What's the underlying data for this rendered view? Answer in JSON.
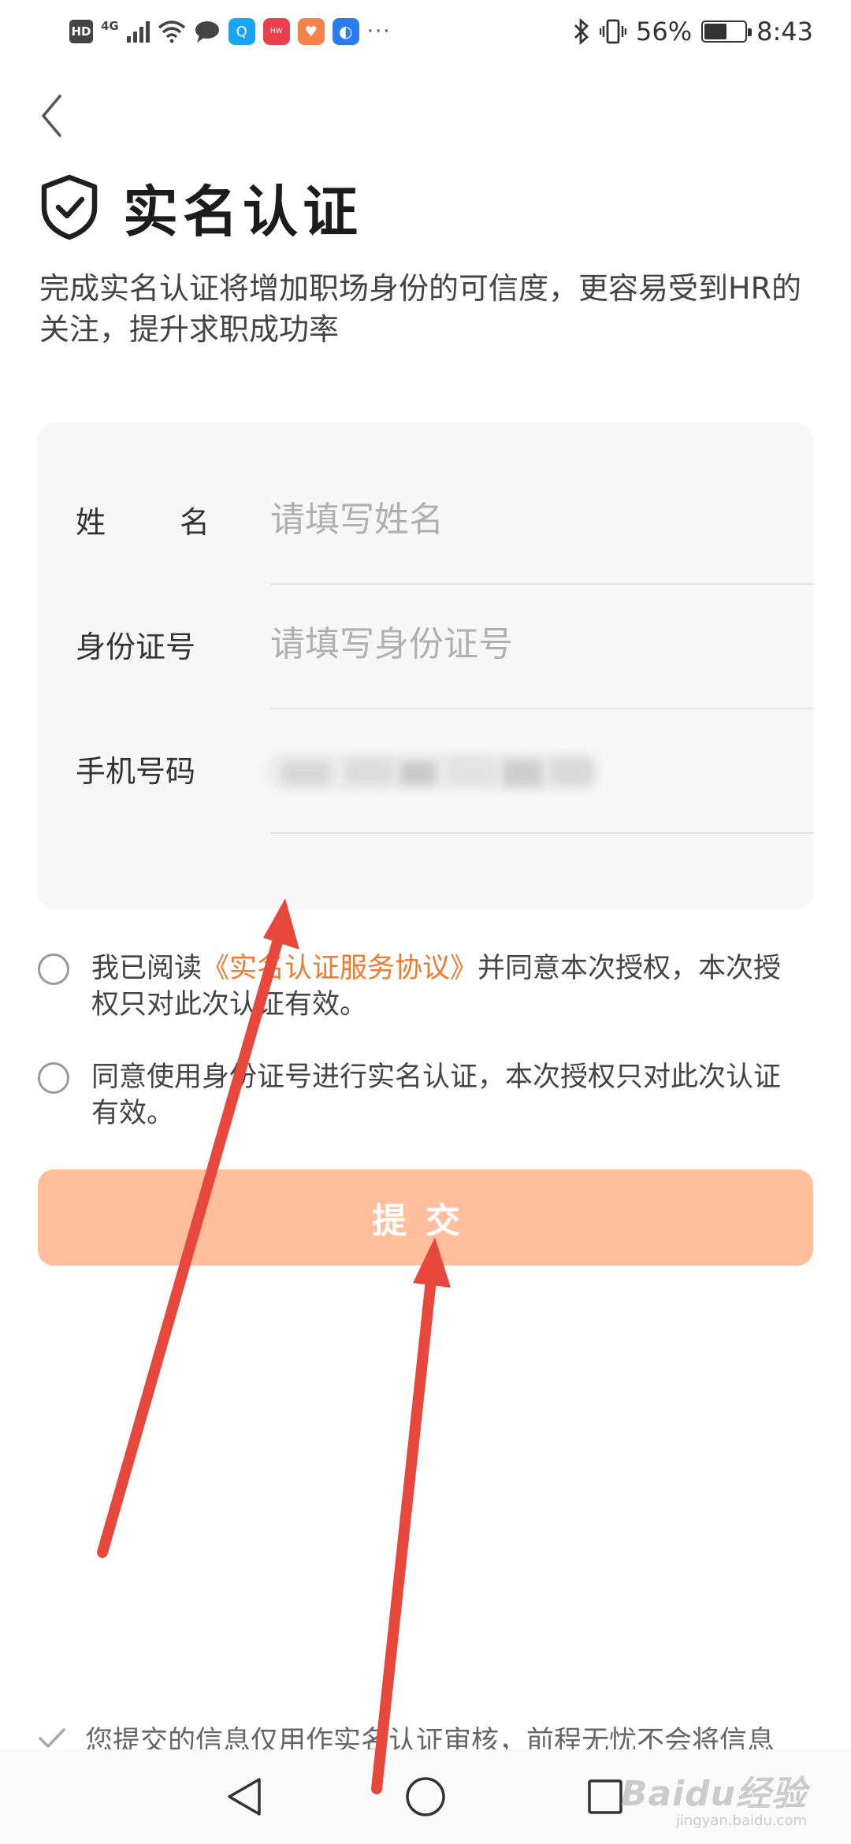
{
  "status_bar": {
    "hd": "HD",
    "network": "4G",
    "battery_text": "56%",
    "battery_level": 0.56,
    "time": "8:43",
    "app_icons": [
      {
        "name": "search-app-icon",
        "color": "#1aa3f0",
        "glyph": "Q"
      },
      {
        "name": "huawei-app-icon",
        "color": "#e8414b",
        "glyph": "HW"
      },
      {
        "name": "health-app-icon",
        "color": "#f5824a",
        "glyph": "♥"
      },
      {
        "name": "tips-app-icon",
        "color": "#2a7cf0",
        "glyph": "💡"
      }
    ],
    "more": "···"
  },
  "header": {
    "title": "实名认证",
    "description": "完成实名认证将增加职场身份的可信度，更容易受到HR的关注，提升求职成功率"
  },
  "form": {
    "name_label_chars": [
      "姓",
      "名"
    ],
    "name_placeholder": "请填写姓名",
    "id_label": "身份证号",
    "id_placeholder": "请填写身份证号",
    "phone_label": "手机号码"
  },
  "agreements": [
    {
      "prefix": "我已阅读",
      "link": "《实名认证服务协议》",
      "suffix": "并同意本次授权，本次授权只对此次认证有效。"
    },
    {
      "text": "同意使用身份证号进行实名认证，本次授权只对此次认证有效。"
    }
  ],
  "submit_label": "提交",
  "footer_note": "您提交的信息仅用作实名认证审核，前程无忧不会将信息",
  "watermark": {
    "logo": "Baidu经验",
    "sub": "jingyan.baidu.com"
  },
  "colors": {
    "accent": "#f07a30",
    "submit_bg": "#ffbf9c",
    "arrow": "#e8483c"
  }
}
